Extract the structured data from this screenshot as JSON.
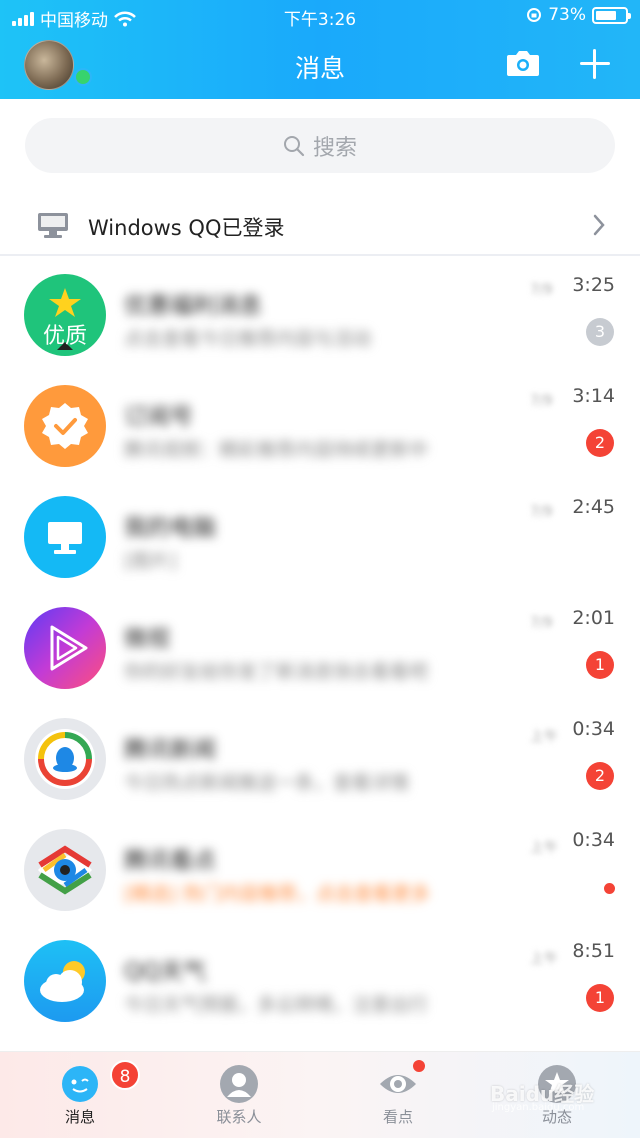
{
  "status_bar": {
    "carrier": "中国移动",
    "time": "下午3:26",
    "battery": "73%",
    "battery_level": 0.73
  },
  "header": {
    "title": "消息"
  },
  "search": {
    "placeholder": "搜索"
  },
  "login_bar": {
    "text": "Windows QQ已登录"
  },
  "messages": [
    {
      "name": "优惠福利消息",
      "preview": "点击查看今日推荐内容与活动",
      "date": "7/9",
      "time": "3:25",
      "badge": "3",
      "badge_style": "gray",
      "avatar_label": "优质",
      "icon": "star-icon"
    },
    {
      "name": "订阅号",
      "preview": "腾讯视频：精彩推荐内容持续更新中",
      "date": "7/9",
      "time": "3:14",
      "badge": "2",
      "badge_style": "red",
      "icon": "verified-badge-icon"
    },
    {
      "name": "我的电脑",
      "preview": "[图片]",
      "date": "7/9",
      "time": "2:45",
      "badge": "",
      "badge_style": "none",
      "icon": "monitor-icon"
    },
    {
      "name": "微视",
      "preview": "你的好友给你发了新消息快去看看吧",
      "date": "7/9",
      "time": "2:01",
      "badge": "1",
      "badge_style": "red",
      "icon": "play-icon"
    },
    {
      "name": "腾讯新闻",
      "preview": "今日热点新闻推送一条，查看详情",
      "date": "上午",
      "time": "0:34",
      "badge": "2",
      "badge_style": "red",
      "icon": "qq-penguin-icon"
    },
    {
      "name": "腾讯看点",
      "preview": "[精选] 热门内容推荐，点击查看更多",
      "date": "上午",
      "time": "0:34",
      "badge": "",
      "badge_style": "dot",
      "icon": "eye-icon"
    },
    {
      "name": "QQ天气",
      "preview": "今日天气预报，多云转晴，注意出行",
      "date": "上午",
      "time": "8:51",
      "badge": "1",
      "badge_style": "red",
      "icon": "weather-icon"
    }
  ],
  "tabs": [
    {
      "label": "消息",
      "badge": "8",
      "icon": "chat-bubble-icon",
      "active": true
    },
    {
      "label": "联系人",
      "icon": "contact-icon",
      "active": false
    },
    {
      "label": "看点",
      "icon": "eye-icon",
      "active": false
    },
    {
      "label": "动态",
      "icon": "star-icon",
      "active": false
    }
  ],
  "watermark": {
    "text": "Baidu经验",
    "sub": "jingyan.baidu.com"
  },
  "colors": {
    "header_start": "#1ec3f7",
    "header_end": "#1aa9fb",
    "badge_red": "#f44336",
    "online_green": "#37d36d"
  }
}
